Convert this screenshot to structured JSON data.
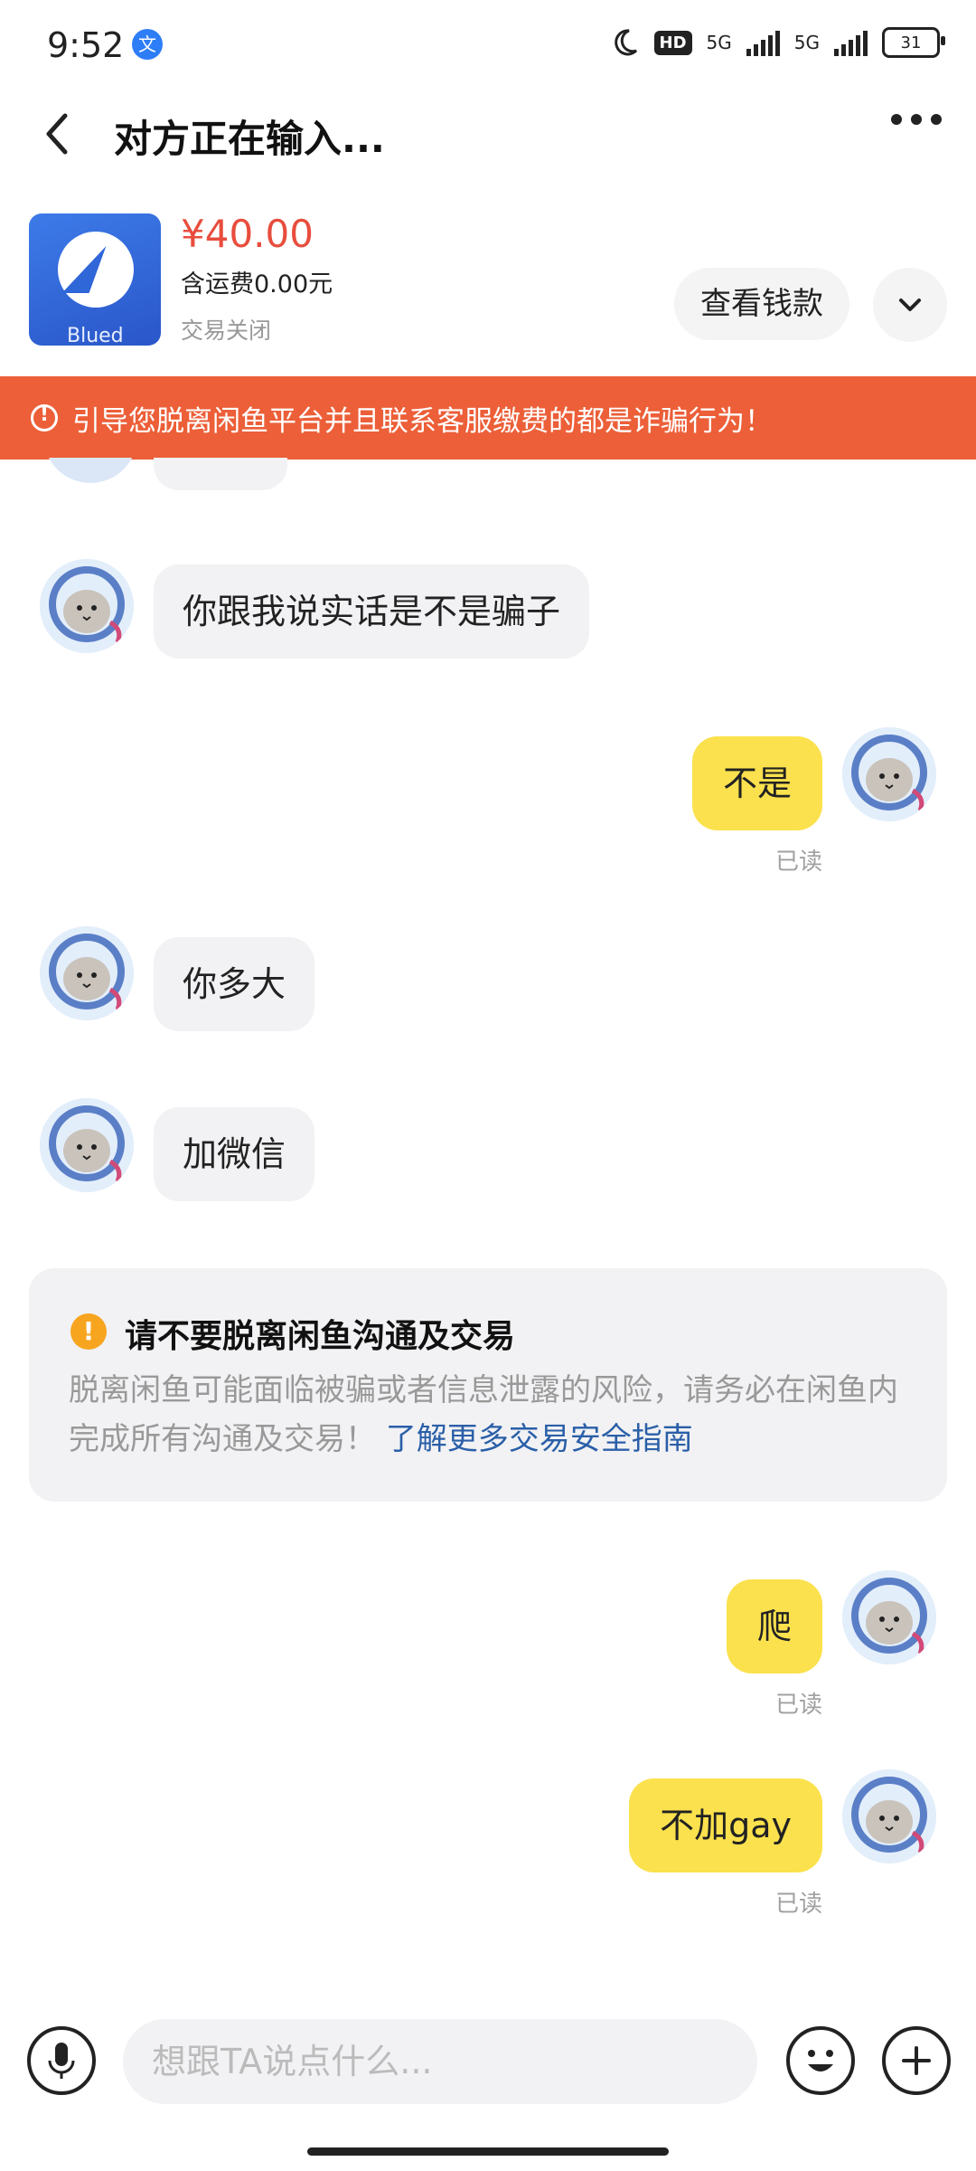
{
  "status_bar": {
    "time": "9:52",
    "hd_label": "HD",
    "net1": "5G",
    "net2": "5G",
    "battery": "31"
  },
  "header": {
    "title": "对方正在输入..."
  },
  "product": {
    "image_text": "Blued",
    "price": "¥40.00",
    "shipping": "含运费0.00元",
    "status": "交易关闭",
    "view_money_label": "查看钱款"
  },
  "banner": {
    "text": "引导您脱离闲鱼平台并且联系客服缴费的都是诈骗行为！"
  },
  "messages": [
    {
      "side": "in",
      "text": "你跟我说实话是不是骗子"
    },
    {
      "side": "out",
      "text": "不是",
      "status": "已读"
    },
    {
      "side": "in",
      "text": "你多大"
    },
    {
      "side": "in",
      "text": "加微信"
    },
    {
      "side": "out",
      "text": "爬",
      "status": "已读"
    },
    {
      "side": "out",
      "text": "不加gay",
      "status": "已读"
    }
  ],
  "notice": {
    "title": "请不要脱离闲鱼沟通及交易",
    "body": "脱离闲鱼可能面临被骗或者信息泄露的风险，请务必在闲鱼内完成所有沟通及交易！",
    "link": "了解更多交易安全指南"
  },
  "input_bar": {
    "placeholder": "想跟TA说点什么..."
  },
  "colors": {
    "accent_yellow": "#fbe14d",
    "banner": "#ec5f38",
    "price": "#e84d3d",
    "link": "#2a5fa8"
  }
}
